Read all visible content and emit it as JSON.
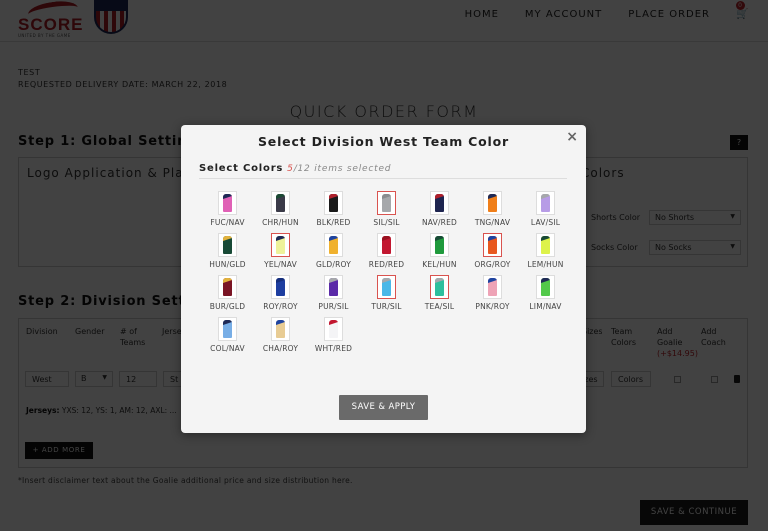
{
  "header": {
    "logo_text": "SCORE",
    "logo_tagline": "UNITED BY THE GAME",
    "nav": [
      "HOME",
      "MY ACCOUNT",
      "PLACE ORDER"
    ],
    "cart_count": "0"
  },
  "order_info": {
    "name": "TEST",
    "delivery": "REQUESTED DELIVERY DATE: MARCH 22, 2018"
  },
  "form_title": "QUICK ORDER FORM",
  "step1": {
    "title": "Step 1: Global Settings",
    "help_label": "?",
    "logo_panel_title": "Logo Application & Placement",
    "colors_panel_title": "Colors",
    "shorts_label": "Shorts Color",
    "shorts_value": "No Shorts",
    "socks_label": "Socks Color",
    "socks_value": "No Socks"
  },
  "step2": {
    "title": "Step 2: Division Settings",
    "columns": [
      "Division",
      "Gender",
      "# of Teams",
      "Jersey",
      "Sizes",
      "Team Colors",
      "Add Goalie",
      "Add Coach"
    ],
    "goalie_price": "(+$14.95)",
    "row": {
      "division": "West",
      "gender": "B",
      "teams": "12",
      "jersey": "St",
      "sizes_btn": "Sizes",
      "colors_btn": "Colors"
    },
    "jerseys_label": "Jerseys:",
    "jerseys_value": "YXS: 12, YS: 1, AM: 12, AXL: ...",
    "add_more": "+ ADD MORE"
  },
  "disclaimer": "*Insert disclaimer text about the Goalie additional price and size distribution here.",
  "save_continue": "SAVE & CONTINUE",
  "modal": {
    "title": "Select Division West Team Color",
    "close": "×",
    "select_label": "Select Colors",
    "selected_count": "5",
    "total_text": "/12 items selected",
    "apply_label": "SAVE & APPLY",
    "colors": [
      {
        "name": "FUC/NAV",
        "main": "#e061b6",
        "accent": "#1f2a56",
        "selected": false
      },
      {
        "name": "CHR/HUN",
        "main": "#3a3a48",
        "accent": "#1c4a35",
        "selected": false
      },
      {
        "name": "BLK/RED",
        "main": "#1a1a1a",
        "accent": "#b0202c",
        "selected": false
      },
      {
        "name": "SIL/SIL",
        "main": "#a6a8ab",
        "accent": "#8a8c8f",
        "selected": true
      },
      {
        "name": "NAV/RED",
        "main": "#1e2550",
        "accent": "#b0202c",
        "selected": false
      },
      {
        "name": "TNG/NAV",
        "main": "#f07f1a",
        "accent": "#1f2a56",
        "selected": false
      },
      {
        "name": "LAV/SIL",
        "main": "#b79ce6",
        "accent": "#a6a8ab",
        "selected": false
      },
      {
        "name": "HUN/GLD",
        "main": "#184a36",
        "accent": "#e2b23c",
        "selected": false
      },
      {
        "name": "YEL/NAV",
        "main": "#eef29a",
        "accent": "#1f2a56",
        "selected": true
      },
      {
        "name": "GLD/ROY",
        "main": "#f0b12e",
        "accent": "#1f44a0",
        "selected": false
      },
      {
        "name": "RED/RED",
        "main": "#c21730",
        "accent": "#9a1020",
        "selected": false
      },
      {
        "name": "KEL/HUN",
        "main": "#1f9a3c",
        "accent": "#184a36",
        "selected": false
      },
      {
        "name": "ORG/ROY",
        "main": "#e8581f",
        "accent": "#1f44a0",
        "selected": true
      },
      {
        "name": "LEM/HUN",
        "main": "#ddf24a",
        "accent": "#184a36",
        "selected": false
      },
      {
        "name": "BUR/GLD",
        "main": "#7a1424",
        "accent": "#e2b23c",
        "selected": false
      },
      {
        "name": "ROY/ROY",
        "main": "#1e3ea0",
        "accent": "#162f7c",
        "selected": false
      },
      {
        "name": "PUR/SIL",
        "main": "#5b2aa8",
        "accent": "#a6a8ab",
        "selected": false
      },
      {
        "name": "TUR/SIL",
        "main": "#4ab8e8",
        "accent": "#a6a8ab",
        "selected": true
      },
      {
        "name": "TEA/SIL",
        "main": "#2fbf9d",
        "accent": "#a6a8ab",
        "selected": true
      },
      {
        "name": "PNK/ROY",
        "main": "#eea3b6",
        "accent": "#1f44a0",
        "selected": false
      },
      {
        "name": "LIM/NAV",
        "main": "#52c94a",
        "accent": "#1f2a56",
        "selected": false
      },
      {
        "name": "COL/NAV",
        "main": "#78aee6",
        "accent": "#1f2a56",
        "selected": false
      },
      {
        "name": "CHA/ROY",
        "main": "#e8cc94",
        "accent": "#1f44a0",
        "selected": false
      },
      {
        "name": "WHT/RED",
        "main": "#f4f4f6",
        "accent": "#c21730",
        "selected": false
      }
    ]
  }
}
